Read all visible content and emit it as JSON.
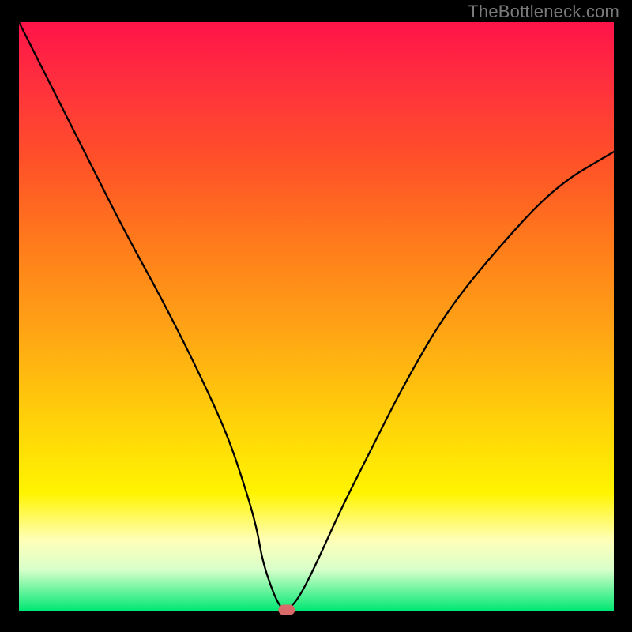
{
  "watermark": "TheBottleneck.com",
  "chart_data": {
    "type": "line",
    "title": "",
    "xlabel": "",
    "ylabel": "",
    "xlim": [
      0,
      100
    ],
    "ylim": [
      0,
      100
    ],
    "series": [
      {
        "name": "curve",
        "x": [
          0,
          6,
          12,
          18,
          24,
          30,
          35,
          38,
          40,
          41,
          43.5,
          45,
          47,
          50,
          54,
          59,
          65,
          72,
          80,
          90,
          100,
          107
        ],
        "values": [
          100,
          88,
          76,
          64,
          53,
          41,
          30,
          21,
          14,
          8,
          1,
          0,
          2,
          8,
          17,
          27,
          39,
          51,
          61,
          72,
          78,
          82
        ]
      }
    ],
    "annotations": [
      {
        "name": "min-marker",
        "x": 45,
        "y": 0
      }
    ],
    "grid": false,
    "legend": false
  },
  "colors": {
    "curve": "#000000",
    "marker": "#d86a6a",
    "gradient_top": "#ff1349",
    "gradient_bottom": "#00e873",
    "background": "#000000"
  }
}
